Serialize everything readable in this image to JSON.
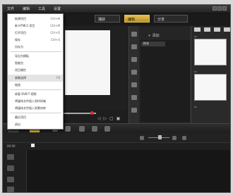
{
  "menubar": {
    "items": [
      "文件",
      "编辑",
      "工具",
      "设置"
    ]
  },
  "tabs": [
    {
      "label": "捕获",
      "active": false
    },
    {
      "label": "编辑",
      "active": true
    },
    {
      "label": "分享",
      "active": false
    }
  ],
  "library": {
    "add_label": "添加",
    "selected_folder": "样本"
  },
  "timeline": {
    "ruler_label": "00:00"
  },
  "file_menu": {
    "items": [
      {
        "label": "新建项目",
        "shortcut": "Ctrl+N"
      },
      {
        "label": "新 HTML5 项目",
        "shortcut": "Ctrl+M"
      },
      {
        "label": "打开项目",
        "shortcut": "Ctrl+O"
      },
      {
        "label": "保存",
        "shortcut": "Ctrl+S"
      },
      {
        "label": "另存为",
        "shortcut": ""
      },
      {
        "label": "导出为模板",
        "shortcut": ""
      },
      {
        "label": "智能包",
        "shortcut": ""
      },
      {
        "label": "项目属性",
        "shortcut": ""
      },
      {
        "label": "参数选择",
        "shortcut": "F6"
      },
      {
        "label": "链接",
        "shortcut": ""
      },
      {
        "label": "修复 DVB-T 视频",
        "shortcut": ""
      },
      {
        "label": "将媒体文件插入到时间轴",
        "shortcut": ""
      },
      {
        "label": "将媒体文件插入到素材库",
        "shortcut": ""
      },
      {
        "label": "最近项目",
        "shortcut": ""
      },
      {
        "label": "退出",
        "shortcut": ""
      }
    ]
  },
  "colors": {
    "accent": "#d9a72e",
    "background": "#1b1b1b",
    "menu_bg": "#ffffff"
  }
}
